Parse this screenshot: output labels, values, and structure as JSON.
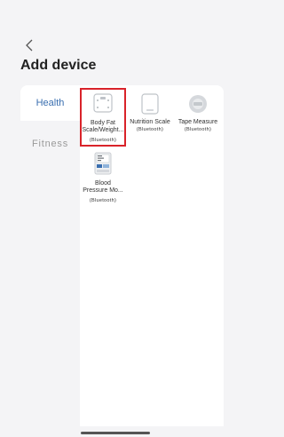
{
  "header": {
    "title": "Add device",
    "back_icon": "chevron-left-icon"
  },
  "sidebar": {
    "items": [
      {
        "label": "Health",
        "state": "active"
      },
      {
        "label": "Fitness",
        "state": "inactive"
      }
    ]
  },
  "devices": [
    {
      "name": "Body Fat",
      "name_line2": "Scale/Weight...",
      "connection": "(Bluetooth)",
      "icon": "body-fat-scale-icon",
      "selected": true
    },
    {
      "name": "Nutrition Scale",
      "name_line2": "",
      "connection": "(Bluetooth)",
      "icon": "nutrition-scale-icon",
      "selected": false
    },
    {
      "name": "Tape Measure",
      "name_line2": "",
      "connection": "(Bluetooth)",
      "icon": "tape-measure-icon",
      "selected": false
    },
    {
      "name": "Blood",
      "name_line2": "Pressure Mo...",
      "connection": "(Bluetooth)",
      "icon": "blood-pressure-monitor-icon",
      "selected": false
    }
  ],
  "colors": {
    "accent": "#3a6fb0",
    "highlight": "#d9232a"
  }
}
